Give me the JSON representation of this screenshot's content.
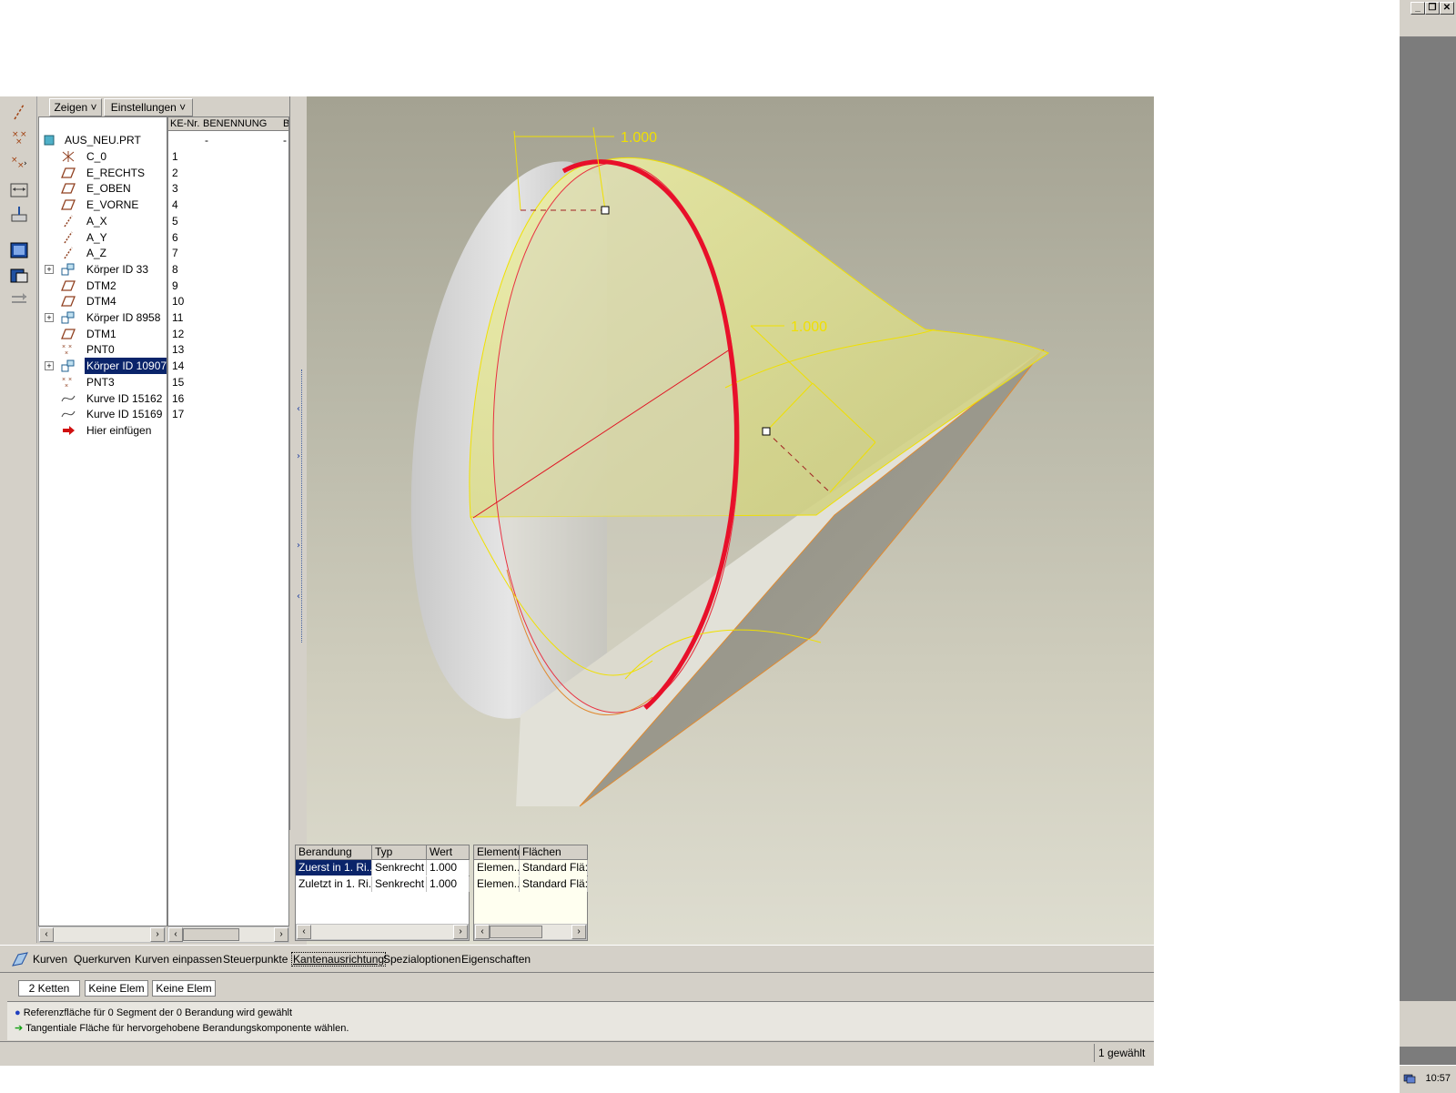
{
  "window": {
    "min_label": "_",
    "restore_label": "❐",
    "close_label": "✕"
  },
  "taskbar": {
    "clock": "10:57"
  },
  "tree": {
    "menus": {
      "show": "Zeigen ˅",
      "settings": "Einstellungen ˅"
    },
    "columns": {
      "ke_nr": "KE-Nr.",
      "name": "BENENNUNG",
      "extra": "B"
    },
    "root": {
      "label": "AUS_NEU.PRT",
      "name": "-",
      "extra": "-"
    },
    "items": [
      {
        "label": "C_0",
        "num": "1",
        "icon": "csys-icon",
        "expand": false,
        "selected": false
      },
      {
        "label": "E_RECHTS",
        "num": "2",
        "icon": "datum-plane-icon",
        "expand": false,
        "selected": false
      },
      {
        "label": "E_OBEN",
        "num": "3",
        "icon": "datum-plane-icon",
        "expand": false,
        "selected": false
      },
      {
        "label": "E_VORNE",
        "num": "4",
        "icon": "datum-plane-icon",
        "expand": false,
        "selected": false
      },
      {
        "label": "A_X",
        "num": "5",
        "icon": "datum-axis-icon",
        "expand": false,
        "selected": false
      },
      {
        "label": "A_Y",
        "num": "6",
        "icon": "datum-axis-icon",
        "expand": false,
        "selected": false
      },
      {
        "label": "A_Z",
        "num": "7",
        "icon": "datum-axis-icon",
        "expand": false,
        "selected": false
      },
      {
        "label": "Körper ID 33",
        "num": "8",
        "icon": "body-icon",
        "expand": true,
        "selected": false
      },
      {
        "label": "DTM2",
        "num": "9",
        "icon": "datum-plane-icon",
        "expand": false,
        "selected": false
      },
      {
        "label": "DTM4",
        "num": "10",
        "icon": "datum-plane-icon",
        "expand": false,
        "selected": false
      },
      {
        "label": "Körper ID 8958",
        "num": "11",
        "icon": "body-icon",
        "expand": true,
        "selected": false
      },
      {
        "label": "DTM1",
        "num": "12",
        "icon": "datum-plane-icon",
        "expand": false,
        "selected": false
      },
      {
        "label": "PNT0",
        "num": "13",
        "icon": "datum-point-icon",
        "expand": false,
        "selected": false
      },
      {
        "label": "Körper ID 10907",
        "num": "14",
        "icon": "body-icon",
        "expand": true,
        "selected": true
      },
      {
        "label": "PNT3",
        "num": "15",
        "icon": "datum-point-icon",
        "expand": false,
        "selected": false
      },
      {
        "label": "Kurve ID 15162",
        "num": "16",
        "icon": "curve-icon",
        "expand": false,
        "selected": false
      },
      {
        "label": "Kurve ID 15169",
        "num": "17",
        "icon": "curve-icon",
        "expand": false,
        "selected": false
      },
      {
        "label": "Hier einfügen",
        "num": "",
        "icon": "insert-here-arrow-icon",
        "expand": false,
        "selected": false
      }
    ]
  },
  "viewport": {
    "dim_top": "1.000",
    "dim_right": "1.000",
    "colors": {
      "surface": "#d8d870",
      "edge_highlight": "#e8102a",
      "dimension": "#f0f000",
      "solid": "#d0d0d0"
    }
  },
  "boundary_table": {
    "headers": {
      "boundary": "Berandung",
      "type": "Typ",
      "value": "Wert"
    },
    "rows": [
      {
        "boundary": "Zuerst in 1. Ri...",
        "type": "Senkrecht",
        "value": "1.000",
        "selected": true
      },
      {
        "boundary": "Zuletzt in 1. Ri...",
        "type": "Senkrecht",
        "value": "1.000",
        "selected": false
      }
    ]
  },
  "elements_table": {
    "headers": {
      "elements": "Elemente",
      "surfaces": "Flächen"
    },
    "rows": [
      {
        "elements": "Elemen...",
        "surfaces": "Standard Flä:F"
      },
      {
        "elements": "Elemen...",
        "surfaces": "Standard Flä:F"
      }
    ]
  },
  "dashboard": {
    "tabs": [
      "Kurven",
      "Querkurven",
      "Kurven einpassen",
      "Steuerpunkte",
      "Kantenausrichtung",
      "Spezialoptionen",
      "Eigenschaften"
    ],
    "active_tab": "Kantenausrichtung",
    "collectors": [
      "2 Ketten",
      "Keine Elem",
      "Keine Elem"
    ]
  },
  "messages": [
    "Referenzfläche für 0 Segment der 0 Berandung wird gewählt",
    "Tangentiale Fläche für hervorgehobene Berandungskomponente wählen."
  ],
  "status": {
    "selected": "1 gewählt"
  }
}
